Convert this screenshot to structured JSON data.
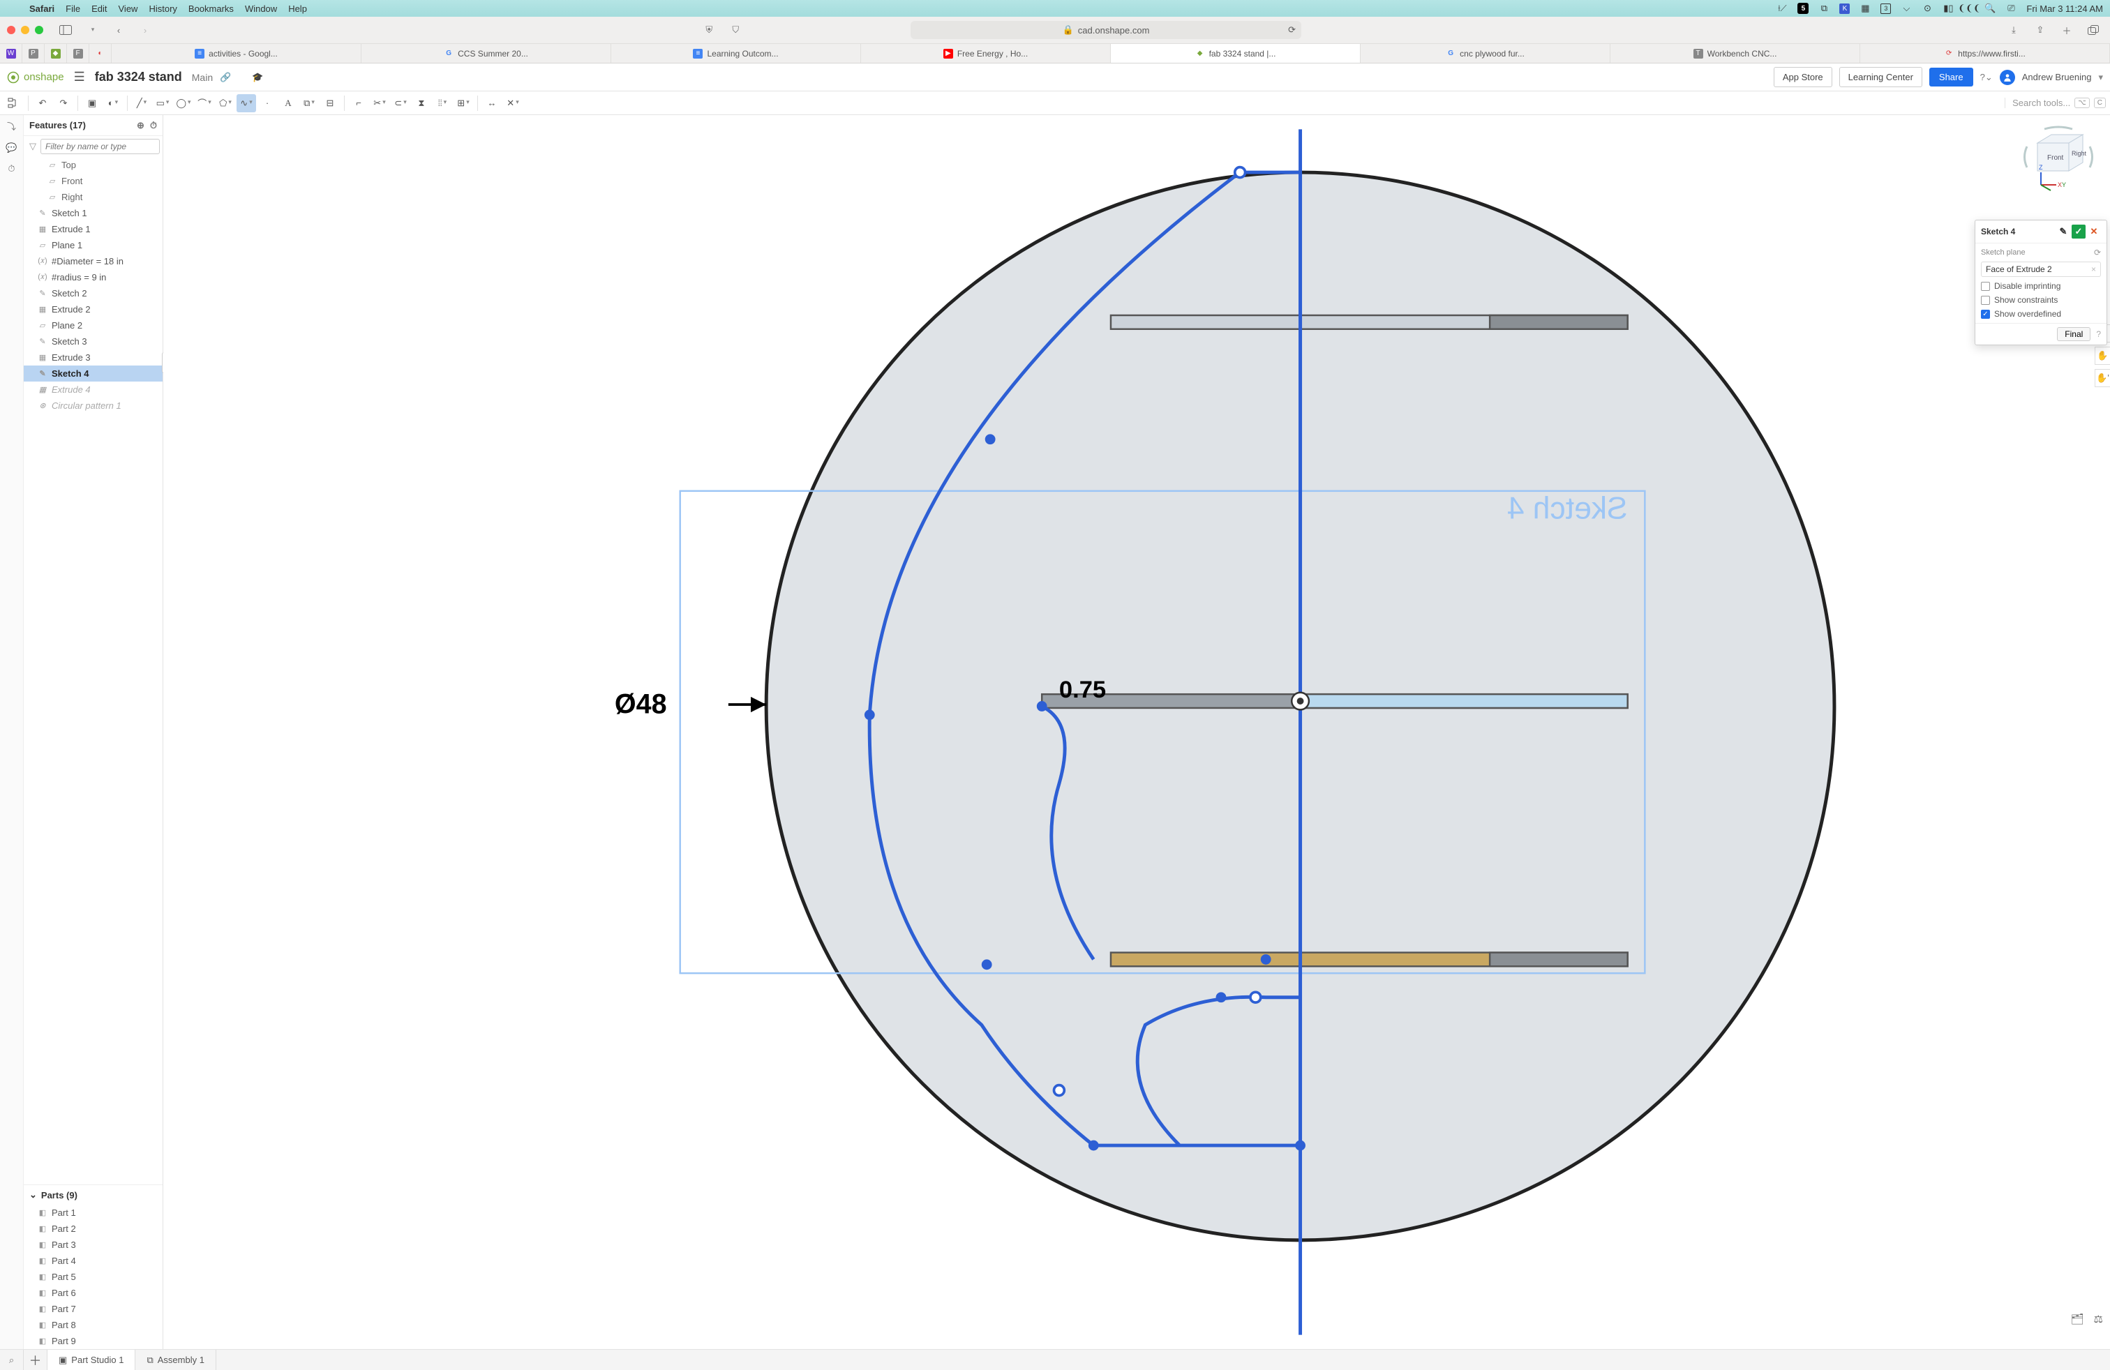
{
  "mac": {
    "app": "Safari",
    "menus": [
      "File",
      "Edit",
      "View",
      "History",
      "Bookmarks",
      "Window",
      "Help"
    ],
    "clock": "Fri Mar 3  11:24 AM"
  },
  "safari": {
    "url_host": "cad.onshape.com",
    "tabs": [
      {
        "label": "activities - Googl...",
        "fav": "gdoc"
      },
      {
        "label": "CCS Summer 20...",
        "fav": "google"
      },
      {
        "label": "Learning Outcom...",
        "fav": "gdoc"
      },
      {
        "label": "Free Energy , Ho...",
        "fav": "yt"
      },
      {
        "label": "fab 3324 stand |...",
        "fav": "onshape",
        "active": true
      },
      {
        "label": "cnc plywood fur...",
        "fav": "google"
      },
      {
        "label": "Workbench CNC...",
        "fav": "gray"
      },
      {
        "label": "https://www.firsti...",
        "fav": "fi"
      }
    ]
  },
  "header": {
    "brand": "onshape",
    "doc_title": "fab 3324 stand",
    "doc_sub": "Main",
    "app_store": "App Store",
    "learning": "Learning Center",
    "share": "Share",
    "user": "Andrew Bruening"
  },
  "search_tools_placeholder": "Search tools...",
  "features": {
    "title": "Features (17)",
    "filter_placeholder": "Filter by name or type",
    "items": [
      {
        "label": "Top",
        "kind": "plane",
        "sub": true
      },
      {
        "label": "Front",
        "kind": "plane",
        "sub": true
      },
      {
        "label": "Right",
        "kind": "plane",
        "sub": true
      },
      {
        "label": "Sketch 1",
        "kind": "sketch"
      },
      {
        "label": "Extrude 1",
        "kind": "extrude"
      },
      {
        "label": "Plane 1",
        "kind": "plane"
      },
      {
        "label": "#Diameter = 18 in",
        "kind": "var"
      },
      {
        "label": "#radius = 9 in",
        "kind": "var"
      },
      {
        "label": "Sketch 2",
        "kind": "sketch"
      },
      {
        "label": "Extrude 2",
        "kind": "extrude"
      },
      {
        "label": "Plane 2",
        "kind": "plane"
      },
      {
        "label": "Sketch 3",
        "kind": "sketch"
      },
      {
        "label": "Extrude 3",
        "kind": "extrude"
      },
      {
        "label": "Sketch 4",
        "kind": "sketch",
        "editing": true
      },
      {
        "label": "Extrude 4",
        "kind": "extrude",
        "suppressed": true
      },
      {
        "label": "Circular pattern 1",
        "kind": "pattern",
        "suppressed": true
      }
    ],
    "parts_title": "Parts (9)",
    "parts": [
      "Part 1",
      "Part 2",
      "Part 3",
      "Part 4",
      "Part 5",
      "Part 6",
      "Part 7",
      "Part 8",
      "Part 9"
    ]
  },
  "canvas": {
    "diam_label": "Ø48",
    "dim_label": "0.75",
    "sketch_name_mirror": "Sketch 4"
  },
  "viewcube": {
    "front": "Front",
    "right": "Right",
    "z": "Z",
    "xy": "X Y"
  },
  "dialog": {
    "title": "Sketch 4",
    "plane_label": "Sketch plane",
    "plane_value": "Face of Extrude 2",
    "disable_imprinting": "Disable imprinting",
    "show_constraints": "Show constraints",
    "show_overdefined": "Show overdefined",
    "final": "Final"
  },
  "bottom_tabs": {
    "part_studio": "Part Studio 1",
    "assembly": "Assembly 1"
  }
}
